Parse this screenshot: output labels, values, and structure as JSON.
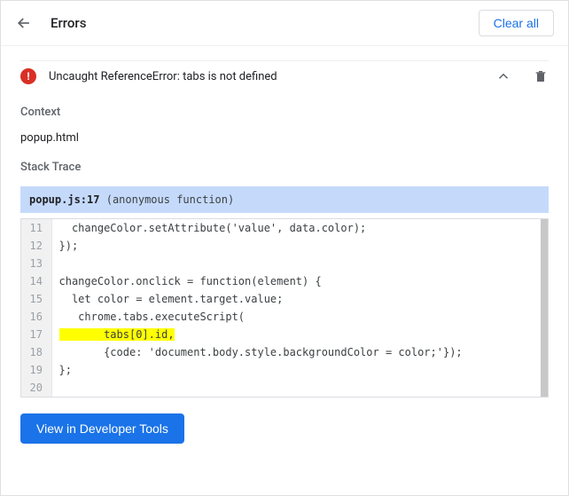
{
  "header": {
    "title": "Errors",
    "clear_label": "Clear all"
  },
  "error": {
    "message": "Uncaught ReferenceError: tabs is not defined"
  },
  "context": {
    "label": "Context",
    "value": "popup.html"
  },
  "stack": {
    "label": "Stack Trace",
    "location": "popup.js:17",
    "fn": "(anonymous function)",
    "highlight_line": 17,
    "lines": [
      {
        "n": 11,
        "text": "  changeColor.setAttribute('value', data.color);"
      },
      {
        "n": 12,
        "text": "});"
      },
      {
        "n": 13,
        "text": ""
      },
      {
        "n": 14,
        "text": "changeColor.onclick = function(element) {"
      },
      {
        "n": 15,
        "text": "  let color = element.target.value;"
      },
      {
        "n": 16,
        "text": "   chrome.tabs.executeScript("
      },
      {
        "n": 17,
        "text": "       tabs[0].id,"
      },
      {
        "n": 18,
        "text": "       {code: 'document.body.style.backgroundColor = color;'});"
      },
      {
        "n": 19,
        "text": "};"
      },
      {
        "n": 20,
        "text": ""
      }
    ]
  },
  "footer": {
    "dev_tools_label": "View in Developer Tools"
  }
}
